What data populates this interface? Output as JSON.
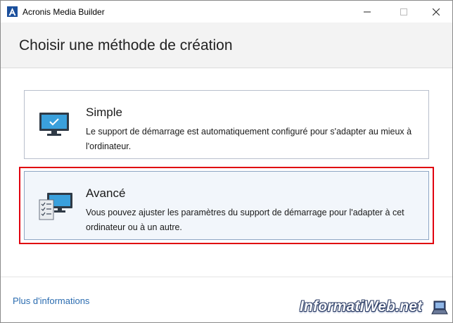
{
  "window": {
    "title": "Acronis Media Builder",
    "logo_letter": "A",
    "controls": [
      "minimize-icon",
      "maximize-icon",
      "close-icon"
    ]
  },
  "header": {
    "title": "Choisir une méthode de création"
  },
  "options": [
    {
      "title": "Simple",
      "description": "Le support de démarrage est automatiquement configuré pour s'adapter au mieux à l'ordinateur.",
      "icon": "monitor-check-icon",
      "selected": false
    },
    {
      "title": "Avancé",
      "description": "Vous pouvez ajuster les paramètres du support de démarrage pour l'adapter à cet ordinateur ou à un autre.",
      "icon": "monitor-checklist-icon",
      "selected": true
    }
  ],
  "footer": {
    "link": "Plus d'informations"
  },
  "watermark": {
    "text": "InformatiWeb.net"
  },
  "colors": {
    "accent": "#2b6cb0",
    "highlight": "#e0000f",
    "header_bg": "#f3f3f3",
    "selected_card_bg": "#f2f6fb"
  }
}
